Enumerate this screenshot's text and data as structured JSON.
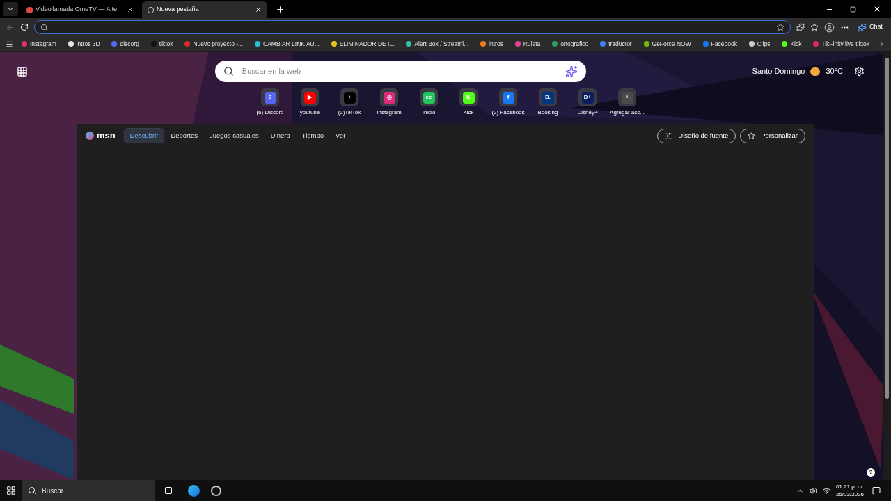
{
  "tabs": [
    {
      "title": "Videollamada OmeTV — Alte",
      "selected": false
    },
    {
      "title": "Nueva pestaña",
      "selected": true
    }
  ],
  "bookmarks": [
    {
      "label": "Instagram",
      "color": "#e1306c"
    },
    {
      "label": "intros 3D",
      "color": "#e5e5e5"
    },
    {
      "label": "discorg",
      "color": "#5865f2"
    },
    {
      "label": "tiktok",
      "color": "#111111"
    },
    {
      "label": "Nuevo proyecto -...",
      "color": "#d92b2b"
    },
    {
      "label": "CAMBIAR LINK AU...",
      "color": "#27c1d8"
    },
    {
      "label": "ELIMINADOR DE I...",
      "color": "#e8c21c"
    },
    {
      "label": "Alert Box / Streaml...",
      "color": "#31c3a2"
    },
    {
      "label": "intros",
      "color": "#f07c1e"
    },
    {
      "label": "Ruleta",
      "color": "#e84393"
    },
    {
      "label": "ortografico",
      "color": "#2e9e5b"
    },
    {
      "label": "traductor",
      "color": "#3b82f6"
    },
    {
      "label": "GeForce NOW",
      "color": "#76b900"
    },
    {
      "label": "Facebook",
      "color": "#1877f2"
    },
    {
      "label": "Clips",
      "color": "#cccccc"
    },
    {
      "label": "Kick",
      "color": "#53fc18"
    },
    {
      "label": "TikFinity live tiktok",
      "color": "#e0245e"
    }
  ],
  "chat_button": "Chat",
  "search": {
    "placeholder": "Buscar en la web"
  },
  "weather": {
    "city": "Santo Domingo",
    "temperature": "30°C"
  },
  "shortcuts": [
    {
      "label": "(6) Discord",
      "color": "#5865f2",
      "glyph": "6"
    },
    {
      "label": "youtube",
      "color": "#ff0000",
      "glyph": "▶"
    },
    {
      "label": "(2)TikTok",
      "color": "#000000",
      "glyph": "♪"
    },
    {
      "label": "Instagram",
      "color": "#dd2a7b",
      "glyph": "◎"
    },
    {
      "label": "Inicio",
      "color": "#22c55e",
      "glyph": "ee"
    },
    {
      "label": "Kick",
      "color": "#53fc18",
      "glyph": "K"
    },
    {
      "label": "(2) Facebook",
      "color": "#1877f2",
      "glyph": "f"
    },
    {
      "label": "Booking",
      "color": "#003580",
      "glyph": "B."
    },
    {
      "label": "Disney+",
      "color": "#0b1f5c",
      "glyph": "D+"
    },
    {
      "label": "Agregar acc...",
      "color": "#4b4b4b",
      "glyph": "+"
    }
  ],
  "msn_logo": "msn",
  "feed_tabs": [
    {
      "label": "Descubrir",
      "selected": true
    },
    {
      "label": "Deportes",
      "selected": false
    },
    {
      "label": "Juegos casuales",
      "selected": false
    },
    {
      "label": "Dinero",
      "selected": false
    },
    {
      "label": "Tiempo",
      "selected": false
    },
    {
      "label": "Ver",
      "selected": false
    }
  ],
  "feed_buttons": [
    "Diseño de fuente",
    "Personalizar"
  ],
  "help": "?",
  "taskbar": {
    "search_placeholder": "Buscar",
    "time": "01:21 p. m.",
    "date": "25/03/2026"
  }
}
